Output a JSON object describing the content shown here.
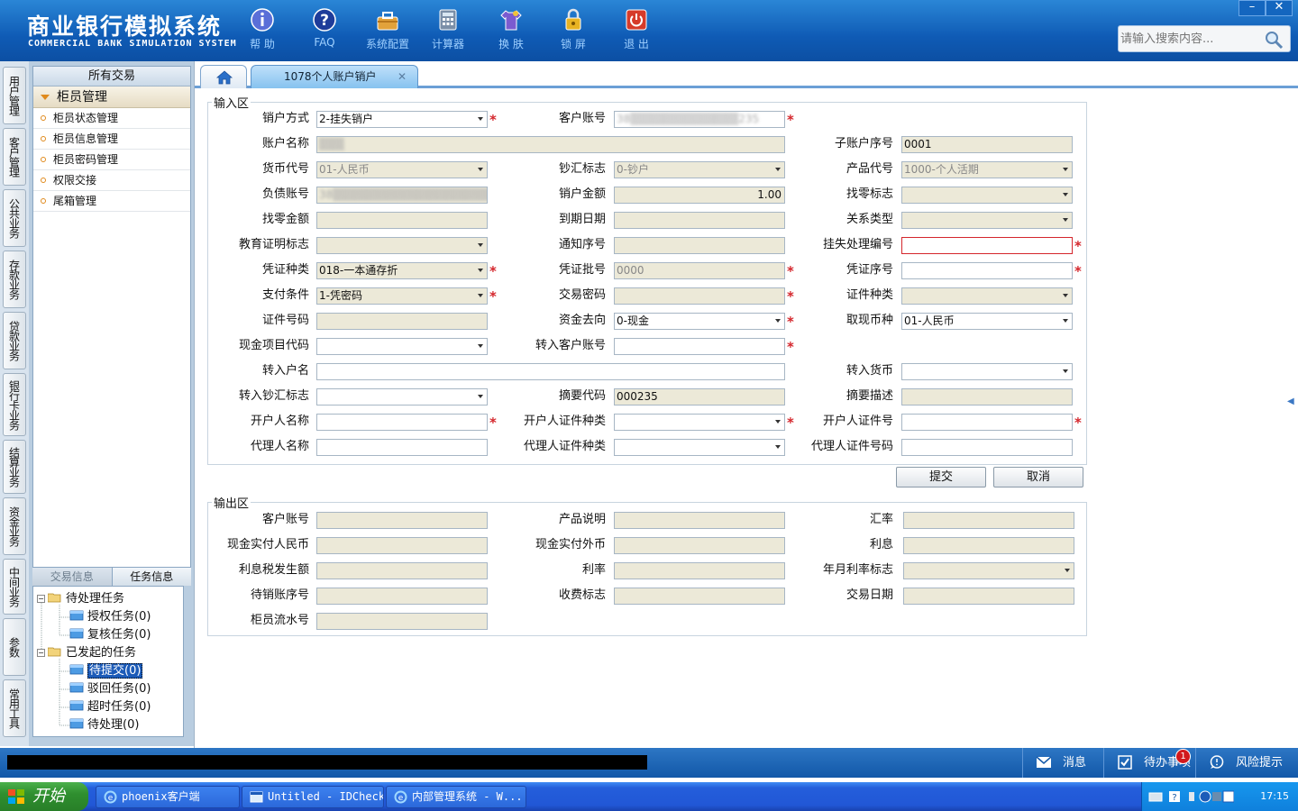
{
  "header": {
    "brand_cn": "商业银行模拟系统",
    "brand_en": "COMMERCIAL BANK SIMULATION SYSTEM",
    "tools": [
      {
        "label": "帮 助",
        "icon": "info-icon"
      },
      {
        "label": "FAQ",
        "icon": "question-icon"
      },
      {
        "label": "系统配置",
        "icon": "toolbox-icon"
      },
      {
        "label": "计算器",
        "icon": "calculator-icon"
      },
      {
        "label": "换 肤",
        "icon": "tshirt-icon"
      },
      {
        "label": "锁 屏",
        "icon": "lock-icon"
      },
      {
        "label": "退 出",
        "icon": "power-icon"
      }
    ],
    "search_placeholder": "请输入搜索内容...",
    "window_controls": [
      "–",
      "✕"
    ]
  },
  "vtabs": [
    "用户管理",
    "客户管理",
    "公共业务",
    "存款业务",
    "贷款业务",
    "银行卡业务",
    "结算业务",
    "资金业务",
    "中间业务",
    "参数",
    "常用工具"
  ],
  "menu": {
    "title": "所有交易",
    "group": "柜员管理",
    "items": [
      "柜员状态管理",
      "柜员信息管理",
      "柜员密码管理",
      "权限交接",
      "尾箱管理"
    ]
  },
  "tasks": {
    "tabs": [
      "交易信息",
      "任务信息"
    ],
    "pending": "待处理任务",
    "auth": "授权任务(0)",
    "review": "复核任务(0)",
    "initiated": "已发起的任务",
    "to_submit": "待提交(0)",
    "rejected": "驳回任务(0)",
    "timeout": "超时任务(0)",
    "to_process": "待处理(0)"
  },
  "tab": {
    "title": "1078个人账户销户",
    "close": "✕"
  },
  "input": {
    "legend": "输入区",
    "close_method_label": "销户方式",
    "close_method": "2-挂失销户",
    "account_label": "客户账号",
    "account": "38▒▒▒▒▒▒▒▒▒▒▒▒▒235",
    "account_name_label": "账户名称",
    "account_name": "▒▒▒",
    "sub_seq_label": "子账户序号",
    "sub_seq": "0001",
    "currency_label": "货币代号",
    "currency": "01-人民币",
    "cash_flag_label": "钞汇标志",
    "cash_flag": "0-钞户",
    "product_label": "产品代号",
    "product": "1000-个人活期",
    "debt_label": "负债账号",
    "debt": "38▒▒▒▒▒▒▒▒▒▒▒▒▒▒▒▒▒▒▒",
    "close_amt_label": "销户金额",
    "close_amt": "1.00",
    "change_flag_label": "找零标志",
    "change_amt_label": "找零金额",
    "due_label": "到期日期",
    "relation_label": "关系类型",
    "edu_label": "教育证明标志",
    "notice_label": "通知序号",
    "loss_no_label": "挂失处理编号",
    "voucher_type_label": "凭证种类",
    "voucher_type": "018-一本通存折",
    "voucher_batch_label": "凭证批号",
    "voucher_batch": "0000",
    "voucher_seq_label": "凭证序号",
    "pay_cond_label": "支付条件",
    "pay_cond": "1-凭密码",
    "trade_pwd_label": "交易密码",
    "id_type_label": "证件种类",
    "id_no_label": "证件号码",
    "fund_dir_label": "资金去向",
    "fund_dir": "0-现金",
    "cash_cur_label": "取现币种",
    "cash_cur": "01-人民币",
    "cash_item_label": "现金项目代码",
    "in_account_label": "转入客户账号",
    "in_name_label": "转入户名",
    "in_currency_label": "转入货币",
    "in_cash_flag_label": "转入钞汇标志",
    "summary_code_label": "摘要代码",
    "summary_code": "000235",
    "summary_desc_label": "摘要描述",
    "opener_name_label": "开户人名称",
    "opener_id_type_label": "开户人证件种类",
    "opener_id_no_label": "开户人证件号",
    "agent_name_label": "代理人名称",
    "agent_id_type_label": "代理人证件种类",
    "agent_id_no_label": "代理人证件号码",
    "required_mark": "*"
  },
  "buttons": {
    "submit": "提交",
    "cancel": "取消"
  },
  "output": {
    "legend": "输出区",
    "account_label": "客户账号",
    "product_desc_label": "产品说明",
    "rate_label": "汇率",
    "cash_rmb_label": "现金实付人民币",
    "cash_fx_label": "现金实付外币",
    "interest_label": "利息",
    "tax_label": "利息税发生额",
    "int_rate_label": "利率",
    "ym_rate_flag_label": "年月利率标志",
    "pending_seq_label": "待销账序号",
    "fee_flag_label": "收费标志",
    "trade_date_label": "交易日期",
    "teller_seq_label": "柜员流水号"
  },
  "statusbar": {
    "message": "消息",
    "todo": "待办事项",
    "risk": "风险提示",
    "badge": "1"
  },
  "taskbar": {
    "start": "开始",
    "tasks": [
      "phoenix客户端",
      "Untitled - IDCheck",
      "内部管理系统 - W..."
    ],
    "clock": "17:15"
  },
  "colors": {
    "header": "#0f5bb5",
    "required": "#d4262c",
    "readonly": "#ece9d8",
    "taskbar": "#2157d6"
  }
}
